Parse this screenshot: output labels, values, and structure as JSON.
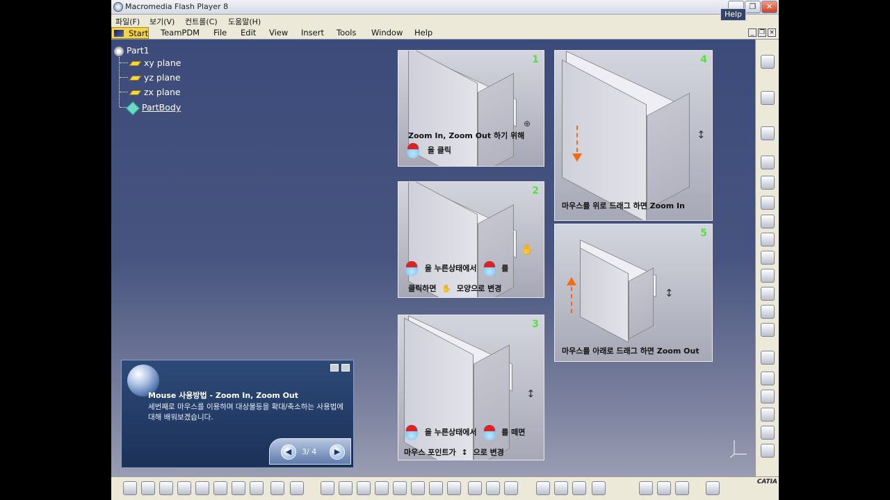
{
  "titlebar": {
    "title": "Macromedia Flash Player 8",
    "min": "▁",
    "max": "❐",
    "close": "✕"
  },
  "flash_menu": [
    "파일(F)",
    "보기(V)",
    "컨트롤(C)",
    "도움말(H)"
  ],
  "catia_menu": {
    "start": "Start",
    "items": [
      "TeamPDM",
      "File",
      "Edit",
      "View",
      "Insert",
      "Tools",
      "Window",
      "Help"
    ]
  },
  "help_button": "Help",
  "tree": {
    "root": "Part1",
    "items": [
      "xy plane",
      "yz plane",
      "zx plane"
    ],
    "body": "PartBody"
  },
  "panels": [
    {
      "num": "1",
      "line1": "Zoom In, Zoom Out 하기 위해",
      "line2": "을 클릭"
    },
    {
      "num": "2",
      "line1a": "을 누른상태에서",
      "line1b": "를",
      "line2a": "클릭하면",
      "line2b": "모양으로 변경"
    },
    {
      "num": "3",
      "line1a": "을 누른상태에서",
      "line1b": "를 떼면",
      "line2a": "마우스 포인트가",
      "line2b": "으로 변경"
    },
    {
      "num": "4",
      "caption": "마우스를 위로 드래그 하면 Zoom In"
    },
    {
      "num": "5",
      "caption": "마우스를 아래로 드래그 하면 Zoom Out"
    }
  ],
  "tutorial": {
    "heading": "Mouse 사용방법 - Zoom In, Zoom Out",
    "desc": "세번째로 마우스를 이용하며 대상물등을 확대/축소하는 사용법에 대해 배워보겠습니다.",
    "page": "3/  4",
    "prev": "◀",
    "next": "▶"
  },
  "brand": "CATIA"
}
